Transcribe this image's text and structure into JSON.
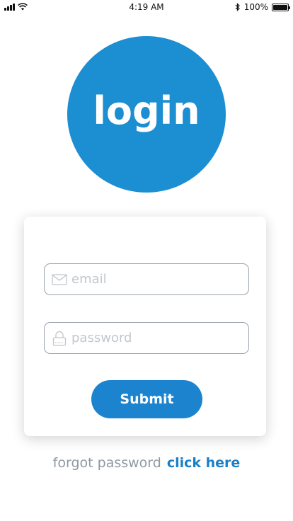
{
  "status_bar": {
    "time": "4:19 AM",
    "battery_percent": "100%"
  },
  "logo": {
    "text": "login",
    "color": "#1c8ed2"
  },
  "form": {
    "email_placeholder": "email",
    "password_placeholder": "password",
    "email_icon": "envelope-icon",
    "password_icon": "lock-icon",
    "submit_label": "Submit",
    "accent_color": "#1c84cf"
  },
  "footer": {
    "forgot_text": "forgot password",
    "link_text": "click here"
  }
}
